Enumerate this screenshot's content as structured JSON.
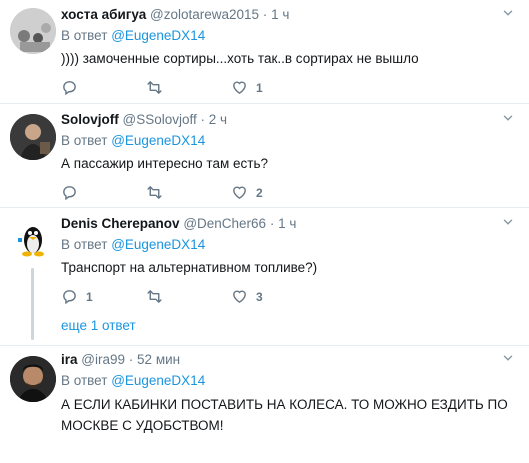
{
  "reply_prefix": "В ответ",
  "tweets": [
    {
      "name": "хоста абигуа",
      "handle": "@zolotarewa2015",
      "time": "1 ч",
      "reply_to": "@EugeneDX14",
      "text": ")))) замоченные сортиры...хоть так..в сортирах не вышло",
      "replies": "",
      "retweets": "",
      "likes": "1"
    },
    {
      "name": "Solovjoff",
      "handle": "@SSolovjoff",
      "time": "2 ч",
      "reply_to": "@EugeneDX14",
      "text": "А пассажир интересно там есть?",
      "replies": "",
      "retweets": "",
      "likes": "2"
    },
    {
      "name": "Denis Cherepanov",
      "handle": "@DenCher66",
      "time": "1 ч",
      "reply_to": "@EugeneDX14",
      "text": "Транспорт на альтернативном топливе?)",
      "replies": "1",
      "retweets": "",
      "likes": "3",
      "more_label": "еще 1 ответ"
    },
    {
      "name": "ira",
      "handle": "@ira99",
      "time": "52 мин",
      "reply_to": "@EugeneDX14",
      "text": "А ЕСЛИ КАБИНКИ ПОСТАВИТЬ НА КОЛЕСА. ТО МОЖНО  ЕЗДИТЬ ПО МОСКВЕ С УДОБСТВОМ!",
      "replies": "",
      "retweets": "",
      "likes": ""
    }
  ],
  "colors": {
    "link": "#1b95e0",
    "muted": "#657786",
    "divider": "#e6ecf0"
  }
}
